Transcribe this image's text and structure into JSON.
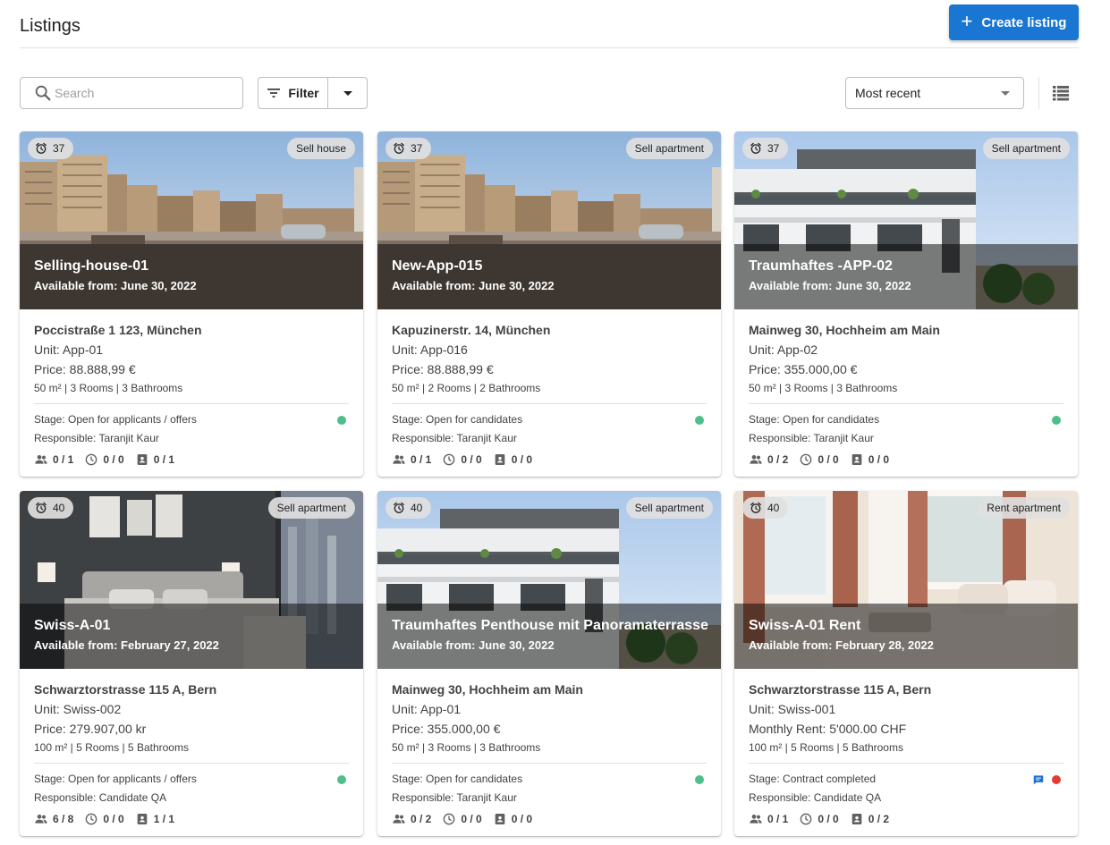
{
  "header": {
    "title": "Listings",
    "create_label": "Create listing"
  },
  "toolbar": {
    "search_placeholder": "Search",
    "filter_label": "Filter",
    "sort_value": "Most recent"
  },
  "colors": {
    "accent": "#1976d2",
    "status_green": "#4ebf8a",
    "status_red": "#e53935"
  },
  "cards": [
    {
      "timer": "37",
      "type": "Sell house",
      "name": "Selling-house-01",
      "available": "Available from: June 30, 2022",
      "address": "Poccistraße 1 123, München",
      "unit": "Unit: App-01",
      "price": "Price: 88.888,99 €",
      "details": "50 m² | 3 Rooms | 3 Bathrooms",
      "stage": "Stage: Open for applicants / offers",
      "responsible": "Responsible: Taranjit Kaur",
      "applicants": "0 / 1",
      "viewings": "0 / 0",
      "contracts": "0 / 1",
      "status": "green",
      "chat": false,
      "photo": "city"
    },
    {
      "timer": "37",
      "type": "Sell apartment",
      "name": "New-App-015",
      "available": "Available from: June 30, 2022",
      "address": "Kapuzinerstr. 14, München",
      "unit": "Unit: App-016",
      "price": "Price: 88.888,99 €",
      "details": "50 m² | 2 Rooms | 2 Bathrooms",
      "stage": "Stage: Open for candidates",
      "responsible": "Responsible: Taranjit Kaur",
      "applicants": "0 / 1",
      "viewings": "0 / 0",
      "contracts": "0 / 0",
      "status": "green",
      "chat": false,
      "photo": "city"
    },
    {
      "timer": "37",
      "type": "Sell apartment",
      "name": "Traumhaftes -APP-02",
      "available": "Available from: June 30, 2022",
      "address": "Mainweg 30, Hochheim am Main",
      "unit": "Unit: App-02",
      "price": "Price: 355.000,00 €",
      "details": "50 m² | 3 Rooms | 3 Bathrooms",
      "stage": "Stage: Open for candidates",
      "responsible": "Responsible: Taranjit Kaur",
      "applicants": "0 / 2",
      "viewings": "0 / 0",
      "contracts": "0 / 0",
      "status": "green",
      "chat": false,
      "photo": "building"
    },
    {
      "timer": "40",
      "type": "Sell apartment",
      "name": "Swiss-A-01",
      "available": "Available from: February 27, 2022",
      "address": "Schwarztorstrasse 115 A, Bern",
      "unit": "Unit: Swiss-002",
      "price": "Price: 279.907,00 kr",
      "details": "100 m² | 5 Rooms | 5 Bathrooms",
      "stage": "Stage: Open for applicants / offers",
      "responsible": "Responsible: Candidate QA",
      "applicants": "6 / 8",
      "viewings": "0 / 0",
      "contracts": "1 / 1",
      "status": "green",
      "chat": false,
      "photo": "bedroom-dark"
    },
    {
      "timer": "40",
      "type": "Sell apartment",
      "name": "Traumhaftes Penthouse mit Panoramaterrasse",
      "available": "Available from: June 30, 2022",
      "address": "Mainweg 30, Hochheim am Main",
      "unit": "Unit: App-01",
      "price": "Price: 355.000,00 €",
      "details": "50 m² | 3 Rooms | 3 Bathrooms",
      "stage": "Stage: Open for candidates",
      "responsible": "Responsible: Taranjit Kaur",
      "applicants": "0 / 2",
      "viewings": "0 / 0",
      "contracts": "0 / 0",
      "status": "green",
      "chat": false,
      "photo": "building"
    },
    {
      "timer": "40",
      "type": "Rent apartment",
      "name": "Swiss-A-01 Rent",
      "available": "Available from: February 28, 2022",
      "address": "Schwarztorstrasse 115 A, Bern",
      "unit": "Unit: Swiss-001",
      "price": "Monthly Rent: 5'000.00 CHF",
      "details": "100 m² | 5 Rooms | 5 Bathrooms",
      "stage": "Stage: Contract completed",
      "responsible": "Responsible: Candidate QA",
      "applicants": "0 / 1",
      "viewings": "0 / 0",
      "contracts": "0 / 2",
      "status": "red",
      "chat": true,
      "photo": "bedroom-light"
    }
  ]
}
